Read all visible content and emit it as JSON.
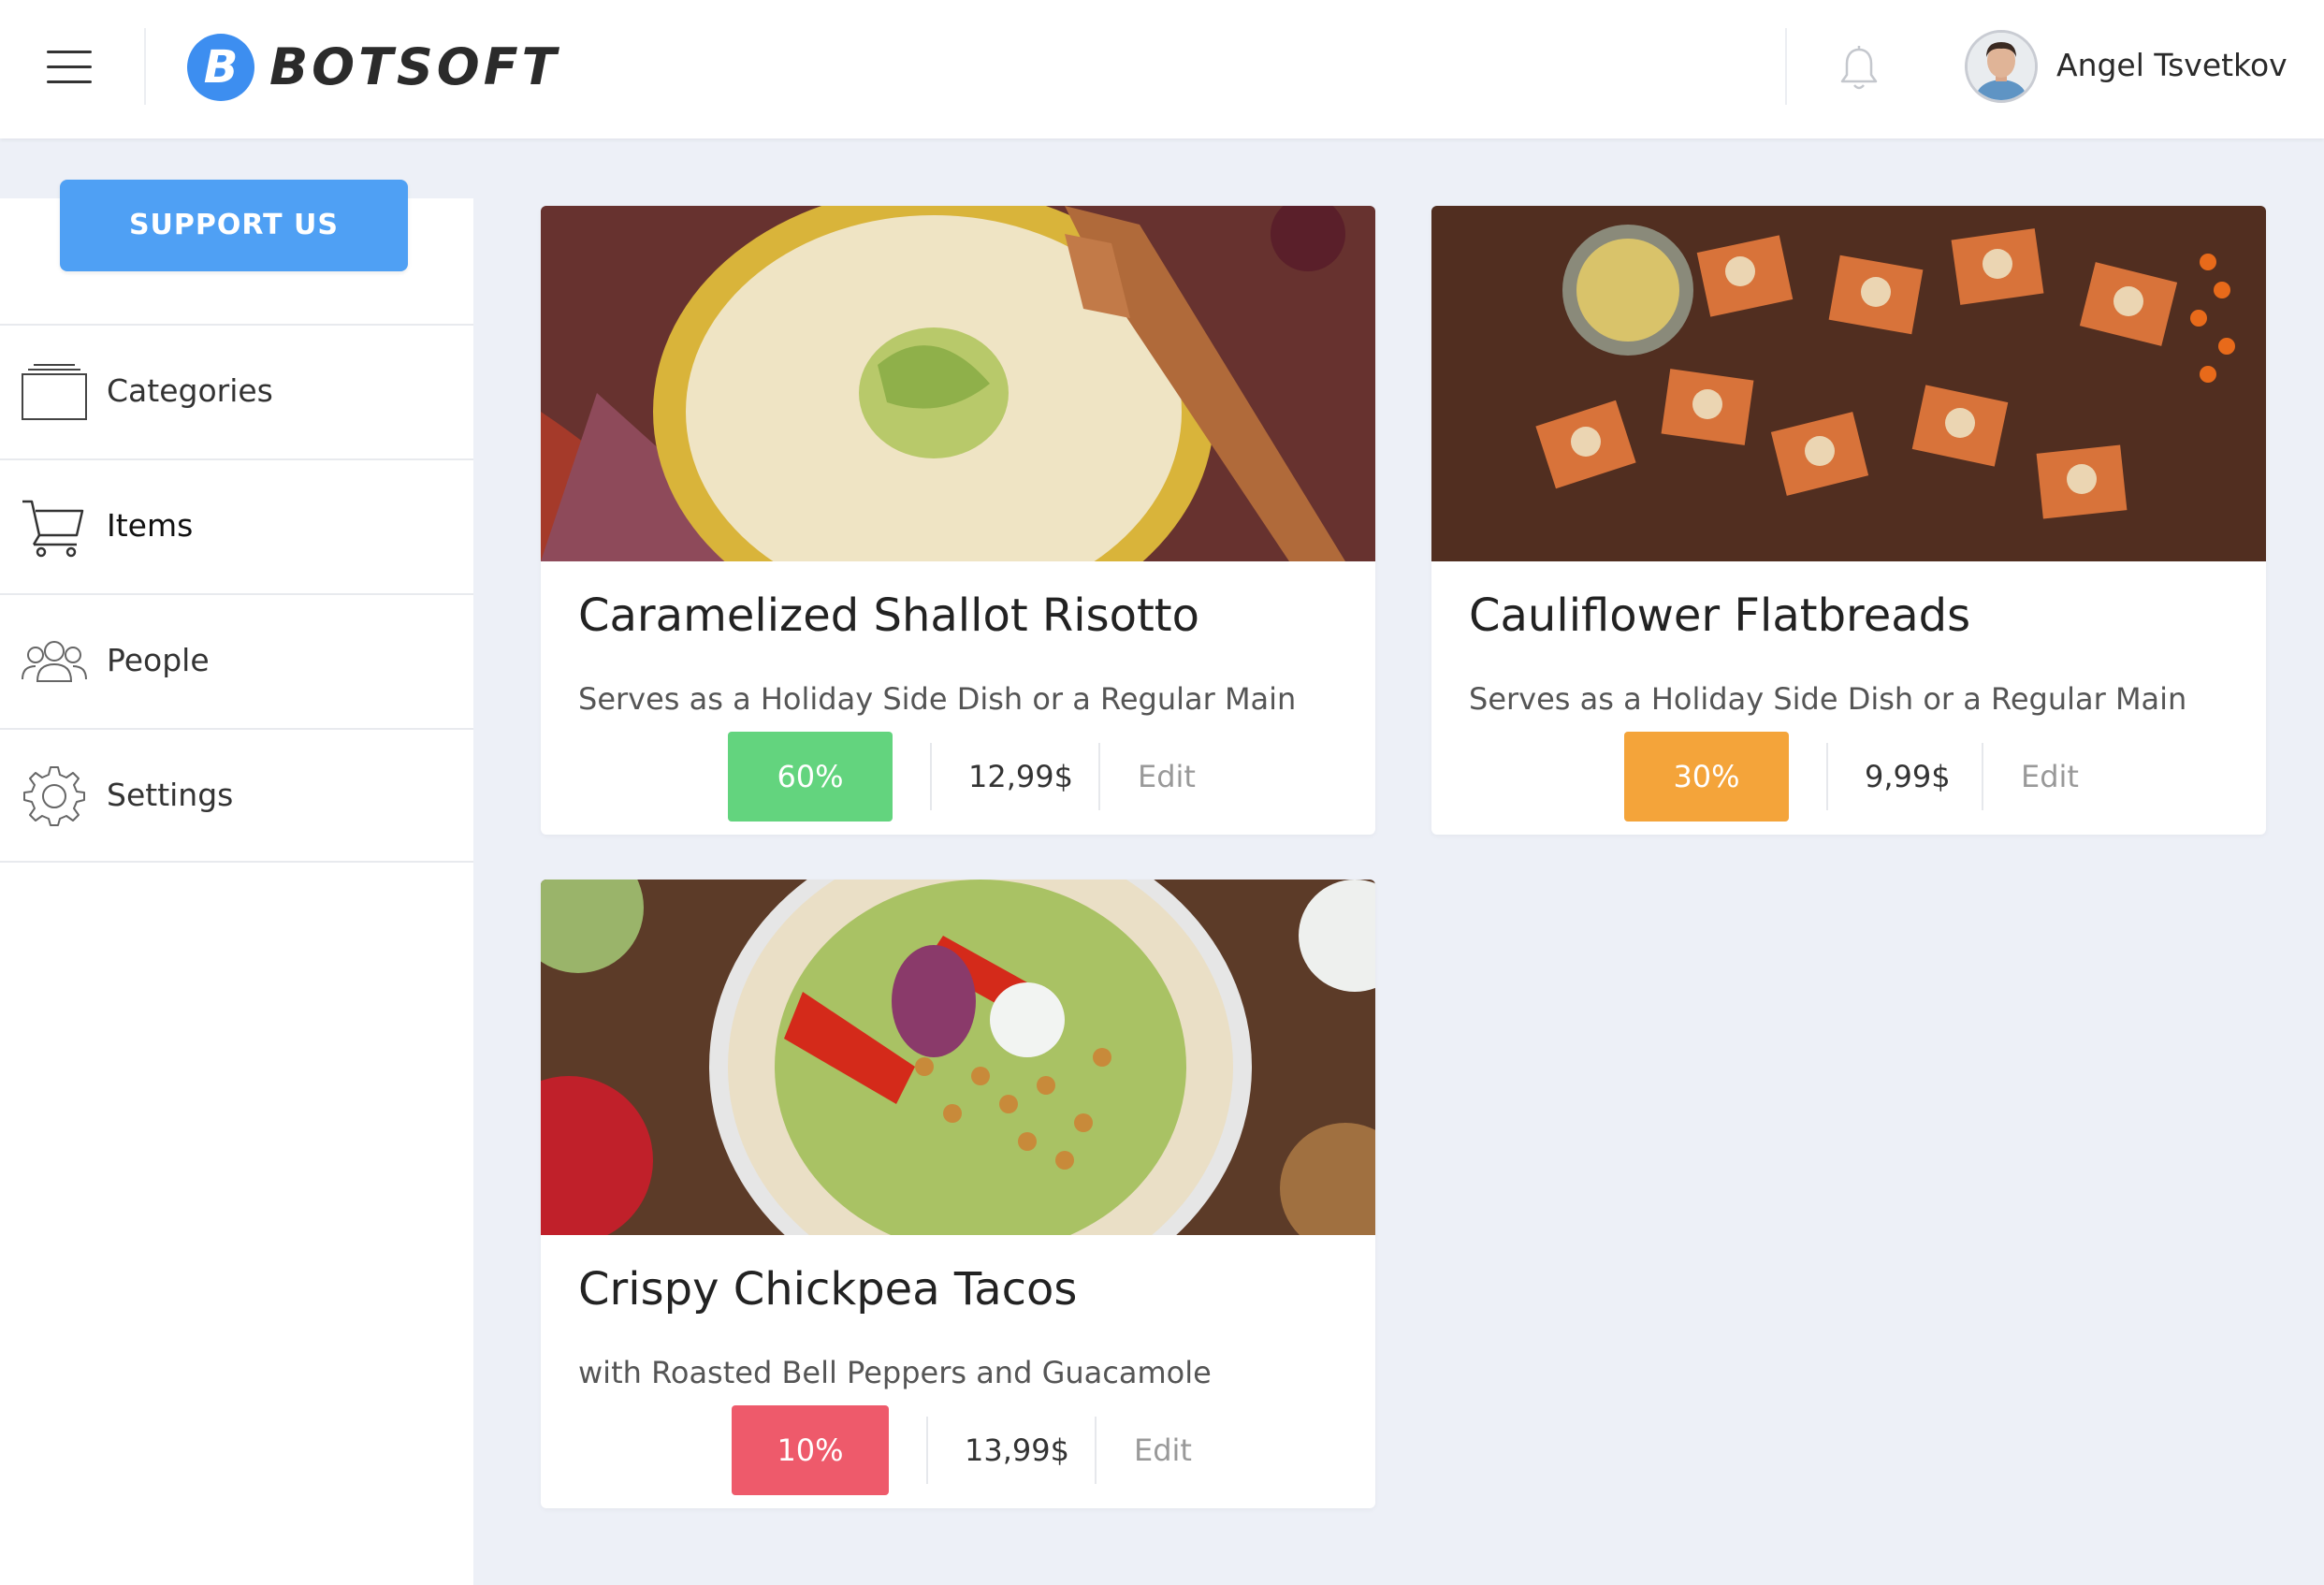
{
  "header": {
    "logo_letter": "B",
    "brand": "BOTSOFT",
    "user_name": "Angel Tsvetkov",
    "icons": [
      "hamburger-icon",
      "bell-icon",
      "avatar"
    ]
  },
  "sidebar": {
    "support_label": "SUPPORT US",
    "items": [
      {
        "label": "Categories",
        "icon": "folder-icon"
      },
      {
        "label": "Items",
        "icon": "cart-icon",
        "active": true
      },
      {
        "label": "People",
        "icon": "people-icon"
      },
      {
        "label": "Settings",
        "icon": "gear-icon"
      }
    ]
  },
  "cards": [
    {
      "title": "Caramelized Shallot Risotto",
      "subtitle": "Serves as a Holiday Side Dish or a Regular Main",
      "discount": "60%",
      "discount_color": "#63d47e",
      "price": "12,99$",
      "edit": "Edit",
      "image": "risotto-photo"
    },
    {
      "title": "Cauliflower Flatbreads",
      "subtitle": "Serves as a Holiday Side Dish or a Regular Main",
      "discount": "30%",
      "discount_color": "#f4a43a",
      "price": "9,99$",
      "edit": "Edit",
      "image": "flatbreads-photo"
    },
    {
      "title": "Crispy Chickpea Tacos",
      "subtitle": "with Roasted Bell Peppers and Guacamole",
      "discount": "10%",
      "discount_color": "#ee5a6b",
      "price": "13,99$",
      "edit": "Edit",
      "image": "tacos-photo"
    }
  ],
  "colors": {
    "accent": "#4fa0f4",
    "background": "#edf0f7"
  }
}
